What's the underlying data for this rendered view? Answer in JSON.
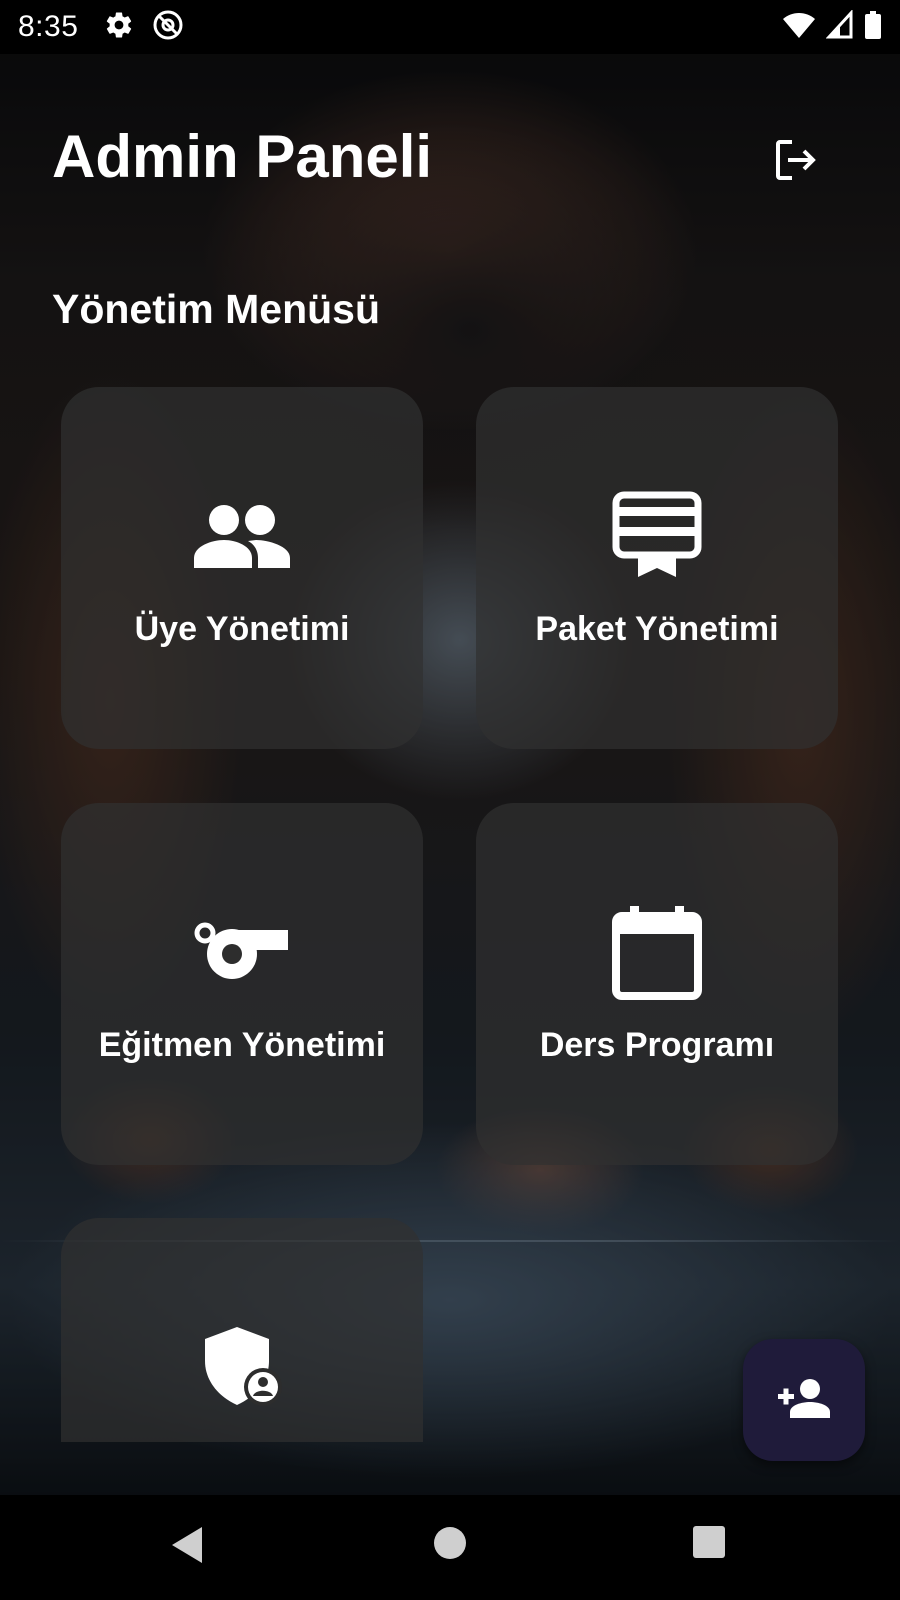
{
  "status_bar": {
    "time": "8:35",
    "left_icons": [
      "settings-icon",
      "at-sign-icon"
    ],
    "right_icons": [
      "wifi-icon",
      "cellular-signal-icon",
      "battery-icon"
    ]
  },
  "header": {
    "title": "Admin Paneli",
    "logout_icon": "logout-icon"
  },
  "section": {
    "title": "Yönetim Menüsü"
  },
  "menu": {
    "items": [
      {
        "label": "Üye Yönetimi",
        "icon": "people-icon"
      },
      {
        "label": "Paket Yönetimi",
        "icon": "card-membership-icon"
      },
      {
        "label": "Eğitmen Yönetimi",
        "icon": "whistle-icon"
      },
      {
        "label": "Ders Programı",
        "icon": "calendar-icon"
      },
      {
        "label": "",
        "icon": "admin-shield-icon"
      }
    ]
  },
  "fab": {
    "icon": "person-add-icon"
  },
  "nav_bar": {
    "buttons": [
      "back-icon",
      "home-icon",
      "recents-icon"
    ]
  },
  "colors": {
    "card_background": "#303030",
    "fab_background": "#1f1b3a",
    "text": "#ffffff"
  }
}
